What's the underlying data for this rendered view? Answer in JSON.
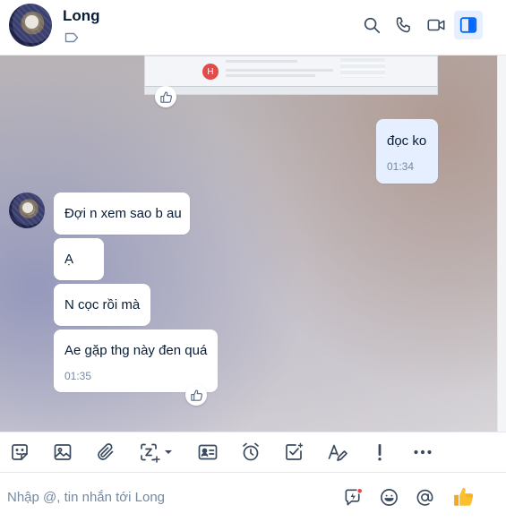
{
  "header": {
    "contact_name": "Long"
  },
  "messages": [
    {
      "side": "mine",
      "text": "đọc ko",
      "time": "01:34"
    },
    {
      "side": "theirs",
      "text": "Đợi n xem sao b au"
    },
    {
      "side": "theirs",
      "text": "Ạ"
    },
    {
      "side": "theirs",
      "text": "N cọc rồi mà"
    },
    {
      "side": "theirs",
      "text": "Ae gặp thg này đen quá",
      "time": "01:35"
    }
  ],
  "screenshot_preview": {
    "avatar_letter": "H"
  },
  "composer": {
    "placeholder": "Nhập @, tin nhắn tới Long"
  },
  "colors": {
    "accent": "#0068ff",
    "own_bubble": "#e5efff",
    "time_text": "#7589a3",
    "notification_dot": "#e24b4b"
  },
  "icons": {
    "header": [
      "search-icon",
      "phone-icon",
      "video-call-icon",
      "sidebar-toggle-icon"
    ],
    "toolbar": [
      "sticker-icon",
      "image-icon",
      "attachment-icon",
      "screenshot-icon",
      "contact-card-icon",
      "reminder-clock-icon",
      "task-icon",
      "text-format-icon",
      "urgent-icon",
      "more-icon"
    ],
    "composer": [
      "quick-message-icon",
      "emoji-icon",
      "mention-icon",
      "thumbs-up-send-icon"
    ]
  }
}
